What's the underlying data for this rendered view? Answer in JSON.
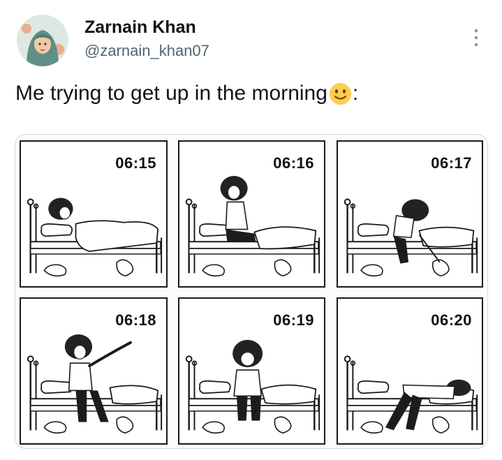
{
  "user": {
    "name": "Zarnain Khan",
    "handle": "@zarnain_khan07",
    "avatar_icon": "avatar-hijab-illustration"
  },
  "more_icon": "more-options-icon",
  "tweet": {
    "text": "Me trying to get up in the morning",
    "emoji": "slightly-smiling-face-emoji",
    "suffix": ":"
  },
  "comic": {
    "panels": [
      {
        "time": "06:15",
        "pose": "lying-in-bed"
      },
      {
        "time": "06:16",
        "pose": "sitting-up"
      },
      {
        "time": "06:17",
        "pose": "leaning-forward"
      },
      {
        "time": "06:18",
        "pose": "stretching"
      },
      {
        "time": "06:19",
        "pose": "sitting-on-edge"
      },
      {
        "time": "06:20",
        "pose": "collapsed-on-bed"
      }
    ]
  },
  "colors": {
    "text_primary": "#0f1419",
    "text_secondary": "#536471",
    "border": "#cfd9de",
    "ink": "#1a1a1a"
  }
}
